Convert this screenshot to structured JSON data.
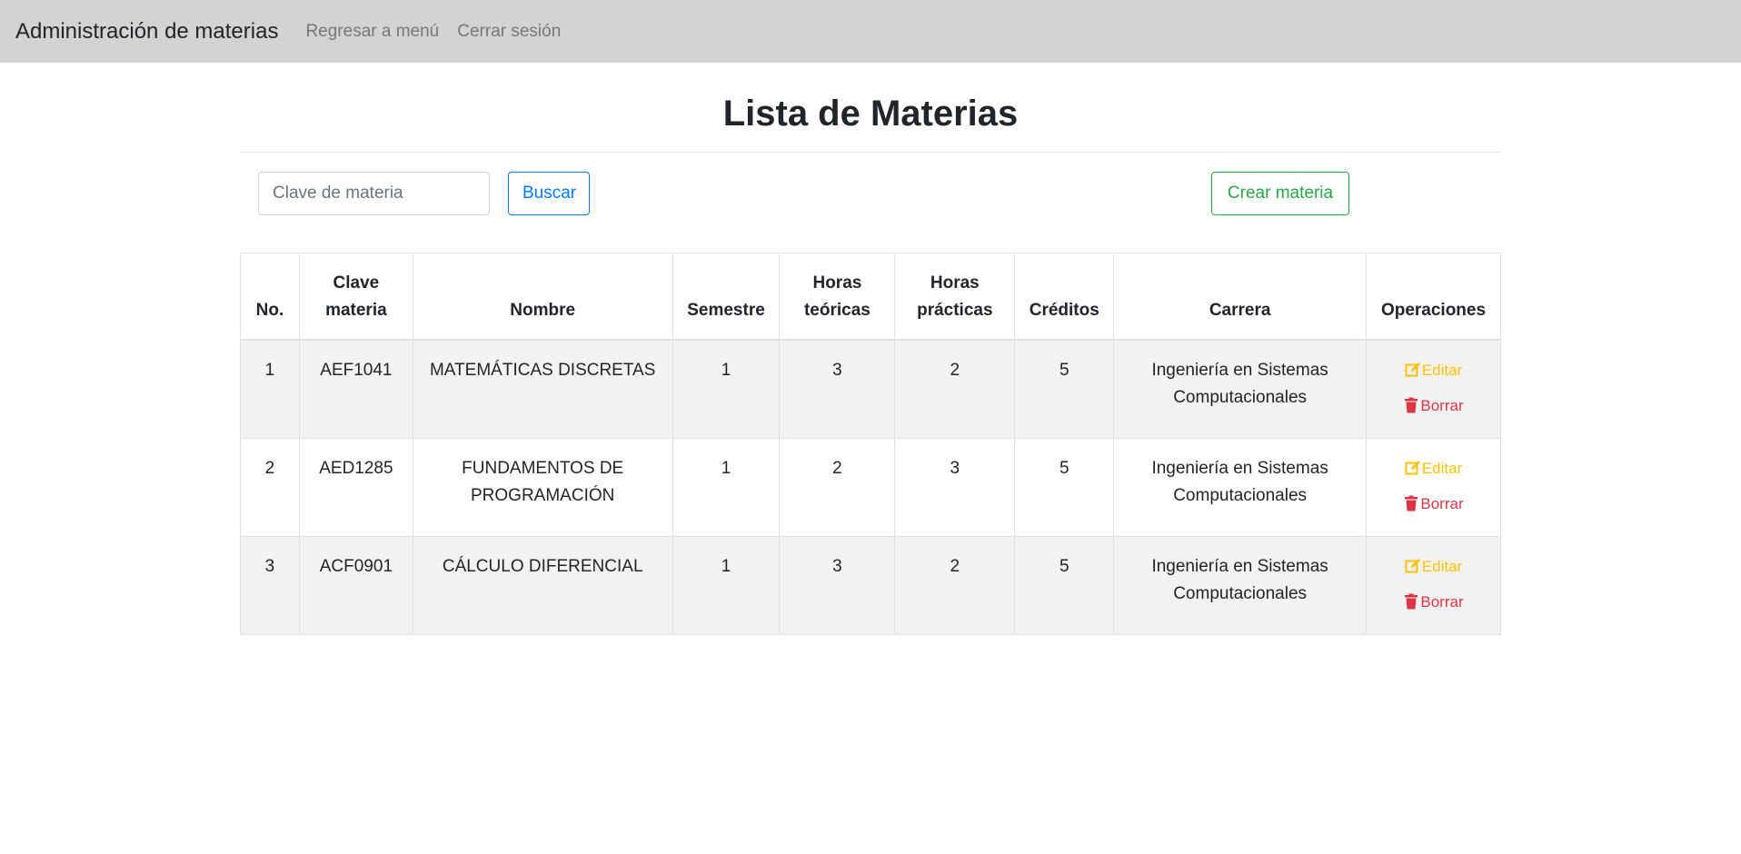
{
  "navbar": {
    "brand": "Administración de materias",
    "links": [
      "Regresar a menú",
      "Cerrar sesión"
    ]
  },
  "page": {
    "title": "Lista de Materias"
  },
  "search": {
    "placeholder": "Clave de materia",
    "value": "",
    "button_label": "Buscar"
  },
  "create_button_label": "Crear materia",
  "table": {
    "headers": [
      "No.",
      "Clave materia",
      "Nombre",
      "Semestre",
      "Horas teóricas",
      "Horas prácticas",
      "Créditos",
      "Carrera",
      "Operaciones"
    ],
    "rows": [
      {
        "no": "1",
        "clave": "AEF1041",
        "nombre": "MATEMÁTICAS DISCRETAS",
        "semestre": "1",
        "horas_teoricas": "3",
        "horas_practicas": "2",
        "creditos": "5",
        "carrera": "Ingeniería en Sistemas Computacionales"
      },
      {
        "no": "2",
        "clave": "AED1285",
        "nombre": "FUNDAMENTOS DE PROGRAMACIÓN",
        "semestre": "1",
        "horas_teoricas": "2",
        "horas_practicas": "3",
        "creditos": "5",
        "carrera": "Ingeniería en Sistemas Computacionales"
      },
      {
        "no": "3",
        "clave": "ACF0901",
        "nombre": "CÁLCULO DIFERENCIAL",
        "semestre": "1",
        "horas_teoricas": "3",
        "horas_practicas": "2",
        "creditos": "5",
        "carrera": "Ingeniería en Sistemas Computacionales"
      }
    ],
    "operations": {
      "edit_label": "Editar",
      "delete_label": "Borrar",
      "edit_icon": "edit-icon",
      "delete_icon": "trash-icon"
    }
  },
  "colors": {
    "navbar_bg": "#d3d3d3",
    "primary": "#007bff",
    "success": "#28a745",
    "warning": "#ffc107",
    "danger": "#dc3545",
    "stripe": "#f2f2f2"
  }
}
